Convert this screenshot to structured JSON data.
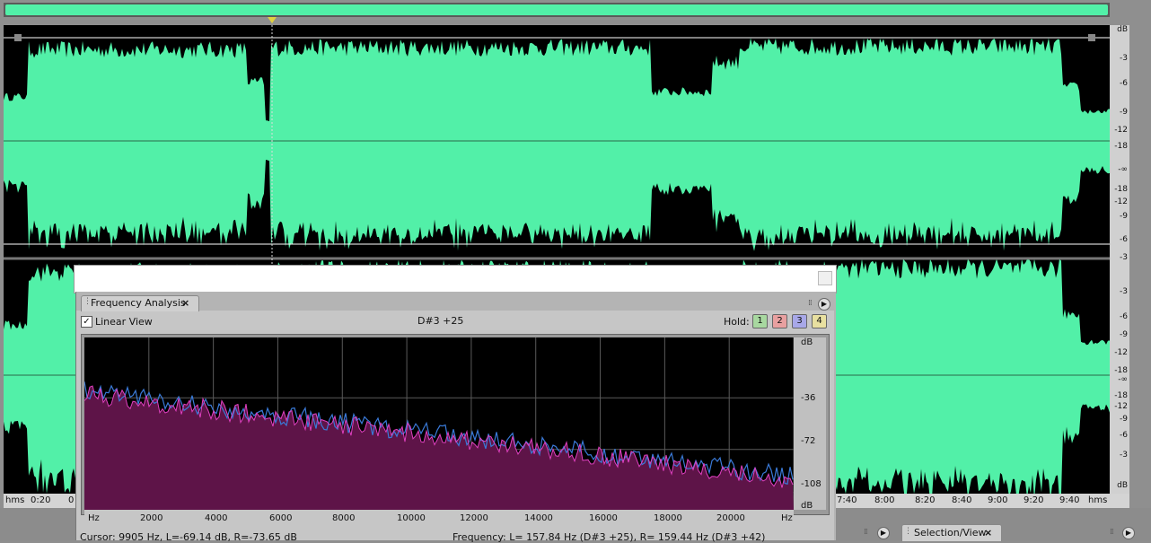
{
  "waveform": {
    "db_scale_top": [
      "dB",
      "-3",
      "-6",
      "-9",
      "-12",
      "-18",
      "-∞",
      "-18",
      "-12",
      "-9",
      "-6",
      "-3"
    ],
    "db_scale_bottom": [
      "-3",
      "-6",
      "-9",
      "-12",
      "-18",
      "-∞",
      "-18",
      "-12",
      "-9",
      "-6",
      "-3",
      "dB"
    ],
    "time_ticks": [
      "hms",
      "0:20",
      "0",
      "7:40",
      "8:00",
      "8:20",
      "8:40",
      "9:00",
      "9:20",
      "9:40",
      "hms"
    ],
    "wave_color": "#52f0a8"
  },
  "frequency_analysis": {
    "tab_label": "Frequency Analysis",
    "close_glyph": "×",
    "linear_view_label": "Linear View",
    "linear_view_checked": "✓",
    "note_readout": "D#3 +25",
    "hold_label": "Hold:",
    "hold_buttons": [
      "1",
      "2",
      "3",
      "4"
    ],
    "hold_colors": [
      "#a8d8a0",
      "#e8a0a0",
      "#a8a8e8",
      "#e8e0a0"
    ],
    "x_ticks": [
      "Hz",
      "2000",
      "4000",
      "6000",
      "8000",
      "10000",
      "12000",
      "14000",
      "16000",
      "18000",
      "20000",
      "Hz"
    ],
    "db_ticks": [
      "dB",
      "-36",
      "-72",
      "-108",
      "dB"
    ],
    "cursor_readout": "Cursor:    9905 Hz, L=-69.14 dB, R=-73.65 dB",
    "frequency_readout": "Frequency:    L= 157.84 Hz (D#3 +25), R= 159.44 Hz (D#3 +42)",
    "fill_color": "#5e1448",
    "left_line_color": "#3a7ad8",
    "right_line_color": "#e040c0"
  },
  "selection_view": {
    "tab_label": "Selection/View",
    "close_glyph": "×"
  }
}
